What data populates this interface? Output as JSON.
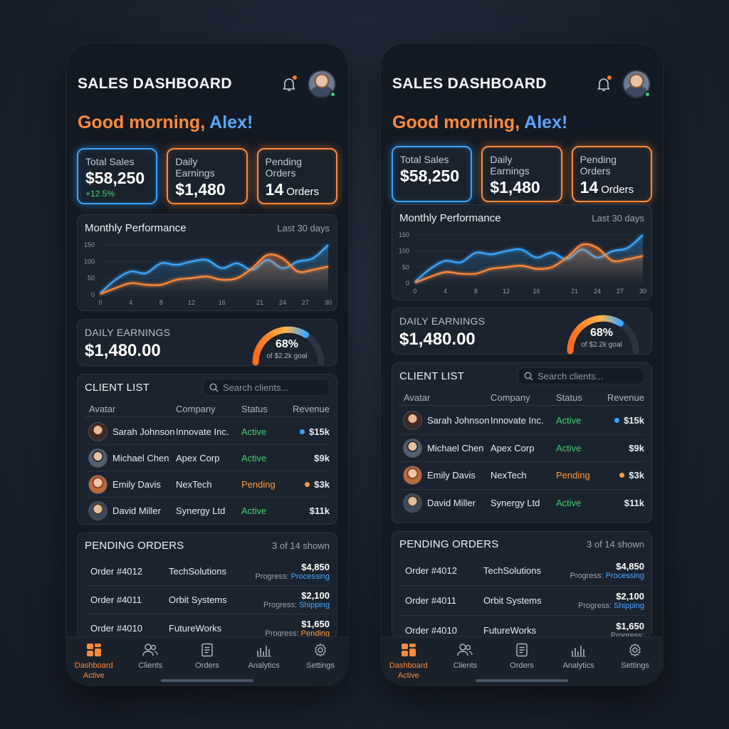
{
  "screens": [
    {
      "header": {
        "title": "SALES DASHBOARD"
      },
      "greeting": {
        "text": "Good morning,",
        "name": "Alex!"
      },
      "stats": [
        {
          "label": "Total Sales",
          "value": "$58,250",
          "change": "+12.5%"
        },
        {
          "label": "Daily Earnings",
          "value": "$1,480"
        },
        {
          "label": "Pending Orders",
          "value": "14",
          "unit": "Orders"
        }
      ],
      "performance": {
        "title": "Monthly Performance",
        "range": "Last 30 days"
      },
      "daily_earnings": {
        "label": "DAILY EARNINGS",
        "amount": "$1,480.00",
        "percent": "68%",
        "goal": "of $2.2k goal",
        "progress": 0.68
      },
      "clients": {
        "title": "CLIENT LIST",
        "search_placeholder": "Search clients...",
        "columns": [
          "Avatar",
          "Company",
          "Status",
          "Revenue"
        ],
        "rows": [
          {
            "name": "Sarah Johnson",
            "company": "Innovate Inc.",
            "status": "Active",
            "revenue": "$15k",
            "dot": "blue"
          },
          {
            "name": "Michael Chen",
            "company": "Apex Corp",
            "status": "Active",
            "revenue": "$9k",
            "dot": ""
          },
          {
            "name": "Emily Davis",
            "company": "NexTech",
            "status": "Pending",
            "revenue": "$3k",
            "dot": "orange"
          },
          {
            "name": "David Miller",
            "company": "Synergy Ltd",
            "status": "Active",
            "revenue": "$11k",
            "dot": ""
          }
        ]
      },
      "orders": {
        "title": "PENDING ORDERS",
        "count": "3 of 14 shown",
        "progress_label": "Progress:",
        "rows": [
          {
            "id": "Order #4012",
            "client": "TechSolutions",
            "amount": "$4,850",
            "state": "Processing",
            "tone": "blue"
          },
          {
            "id": "Order #4011",
            "client": "Orbit Systems",
            "amount": "$2,100",
            "state": "Shipping",
            "tone": "blue"
          },
          {
            "id": "Order #4010",
            "client": "FutureWorks",
            "amount": "$1,650",
            "state": "Pending",
            "tone": "orange"
          }
        ]
      },
      "tabs": [
        {
          "label": "Dashboard",
          "sub": "Active",
          "icon": "dashboard-icon"
        },
        {
          "label": "Clients",
          "icon": "clients-icon"
        },
        {
          "label": "Orders",
          "icon": "orders-icon"
        },
        {
          "label": "Analytics",
          "icon": "analytics-icon"
        },
        {
          "label": "Settings",
          "icon": "settings-icon"
        }
      ]
    },
    {
      "header": {
        "title": "SALES DASHBOARD"
      },
      "greeting": {
        "text": "Good morning,",
        "name": "Alex!"
      },
      "stats": [
        {
          "label": "Total Sales",
          "value": "$58,250"
        },
        {
          "label": "Daily Earnings",
          "value": "$1,480"
        },
        {
          "label": "Pending Orders",
          "value": "14",
          "unit": "Orders"
        }
      ],
      "performance": {
        "title": "Monthly Performance",
        "range": "Last 30 days"
      },
      "daily_earnings": {
        "label": "DAILY EARNINGS",
        "amount": "$1,480.00",
        "percent": "68%",
        "goal": "of $2.2k goal",
        "progress": 0.68
      },
      "clients": {
        "title": "CLIENT LIST",
        "search_placeholder": "Search clients...",
        "columns": [
          "Avatar",
          "Company",
          "Status",
          "Revenue"
        ],
        "rows": [
          {
            "name": "Sarah Johnson",
            "company": "Innovate Inc.",
            "status": "Active",
            "revenue": "$15k",
            "dot": "blue"
          },
          {
            "name": "Michael Chen",
            "company": "Apex Corp",
            "status": "Active",
            "revenue": "$9k",
            "dot": ""
          },
          {
            "name": "Emily Davis",
            "company": "NexTech",
            "status": "Pending",
            "revenue": "$3k",
            "dot": "orange"
          },
          {
            "name": "David Miller",
            "company": "Synergy Ltd",
            "status": "Active",
            "revenue": "$11k",
            "dot": ""
          }
        ]
      },
      "orders": {
        "title": "PENDING ORDERS",
        "count": "3 of 14 shown",
        "progress_label": "Progress:",
        "rows": [
          {
            "id": "Order #4012",
            "client": "TechSolutions",
            "amount": "$4,850",
            "state": "Processing",
            "tone": "blue"
          },
          {
            "id": "Order #4011",
            "client": "Orbit Systems",
            "amount": "$2,100",
            "state": "Shipping",
            "tone": "blue"
          },
          {
            "id": "Order #4010",
            "client": "FutureWorks",
            "amount": "$1,650",
            "state": "",
            "tone": "orange"
          }
        ]
      },
      "tabs": [
        {
          "label": "Dashboard",
          "sub": "Active",
          "icon": "dashboard-icon"
        },
        {
          "label": "Clients",
          "icon": "clients-icon"
        },
        {
          "label": "Orders",
          "icon": "orders-icon"
        },
        {
          "label": "Analytics",
          "icon": "analytics-icon"
        },
        {
          "label": "Settings",
          "icon": "settings-icon"
        }
      ]
    }
  ],
  "chart_data": {
    "type": "area",
    "x": [
      0,
      2,
      4,
      6,
      8,
      10,
      12,
      14,
      16,
      18,
      20,
      22,
      24,
      26,
      28,
      30
    ],
    "xticks": [
      0,
      4,
      8,
      12,
      16,
      21,
      24,
      27,
      30
    ],
    "yticks": [
      0,
      50,
      100,
      150
    ],
    "ylim": [
      0,
      150
    ],
    "xlim": [
      0,
      30
    ],
    "series": [
      {
        "color": "#3aa8ff",
        "values": [
          5,
          45,
          70,
          65,
          95,
          90,
          100,
          105,
          80,
          95,
          75,
          105,
          80,
          100,
          110,
          150
        ]
      },
      {
        "color": "#ff8a3a",
        "values": [
          2,
          20,
          35,
          30,
          30,
          45,
          50,
          55,
          45,
          50,
          80,
          120,
          110,
          70,
          75,
          85
        ]
      }
    ]
  },
  "colors": {
    "accent_orange": "#ff8a3d",
    "accent_blue": "#3aa3ff",
    "active_green": "#40d06f"
  }
}
